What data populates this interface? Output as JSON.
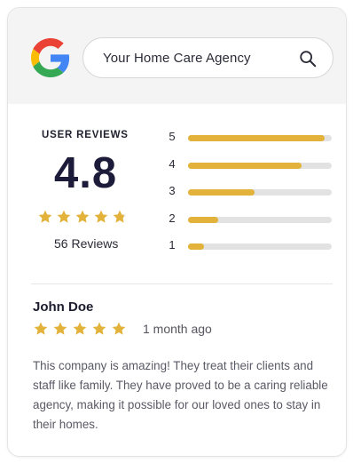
{
  "search": {
    "query": "Your Home Care Agency"
  },
  "summary": {
    "title": "USER REVIEWS",
    "rating": "4.8",
    "rating_stars": 4.8,
    "reviews_count": "56 Reviews"
  },
  "distribution": [
    {
      "label": "5",
      "fraction": 0.95
    },
    {
      "label": "4",
      "fraction": 0.79
    },
    {
      "label": "3",
      "fraction": 0.46
    },
    {
      "label": "2",
      "fraction": 0.21
    },
    {
      "label": "1",
      "fraction": 0.11
    }
  ],
  "review": {
    "name": "John Doe",
    "stars": 5,
    "date": "1 month ago",
    "text": "This company is amazing! They treat their clients and staff like family. They have proved to be a caring reliable agency, making it possible for our loved ones to stay in their homes."
  },
  "colors": {
    "star": "#e2b23a",
    "star_empty": "#e3e3e3",
    "bar_fill": "#e2b23a",
    "bar_track": "#e2e2e2"
  },
  "icons": {
    "logo": "google-logo-icon",
    "search": "search-icon",
    "star": "star-icon"
  }
}
